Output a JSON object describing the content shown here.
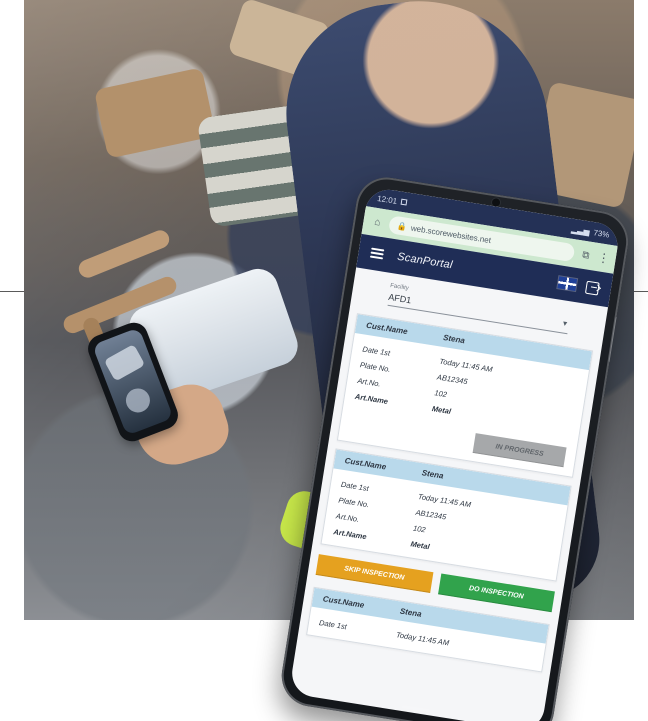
{
  "status": {
    "time": "12:01",
    "battery": "73%"
  },
  "browser": {
    "url": "web.scorewebsites.net"
  },
  "app": {
    "title": "ScanPortal"
  },
  "facility": {
    "label": "Facility",
    "value": "AFD1"
  },
  "cards": [
    {
      "header_left": "Cust.Name",
      "header_right": "Stena",
      "rows": [
        {
          "label": "Date 1st",
          "value": "Today 11:45 AM",
          "bold": false
        },
        {
          "label": "Plate No.",
          "value": "AB12345",
          "bold": false
        },
        {
          "label": "Art.No.",
          "value": "102",
          "bold": false
        },
        {
          "label": "Art.Name",
          "value": "Metal",
          "bold": true
        }
      ],
      "status_button": "IN PROGRESS"
    },
    {
      "header_left": "Cust.Name",
      "header_right": "Stena",
      "rows": [
        {
          "label": "Date 1st",
          "value": "Today 11:45 AM",
          "bold": false
        },
        {
          "label": "Plate No.",
          "value": "AB12345",
          "bold": false
        },
        {
          "label": "Art.No.",
          "value": "102",
          "bold": false
        },
        {
          "label": "Art.Name",
          "value": "Metal",
          "bold": true
        }
      ]
    },
    {
      "header_left": "Cust.Name",
      "header_right": "Stena",
      "rows": [
        {
          "label": "Date 1st",
          "value": "Today 11:45 AM",
          "bold": false
        }
      ]
    }
  ],
  "actions": {
    "skip_label": "SKIP INSPECTION",
    "do_label": "DO INSPECTION"
  },
  "icons": {
    "home": "home-icon",
    "lock": "lock-icon",
    "tabs": "tabs-icon",
    "more": "more-icon",
    "menu": "menu-icon",
    "flag": "uk-flag-icon",
    "logout": "logout-icon",
    "caret": "chevron-down-icon"
  },
  "colors": {
    "header": "#1f2d56",
    "browser_bar": "#cde8cf",
    "card_header": "#b9d9eb",
    "skip": "#e5a11f",
    "do": "#31a34c",
    "status": "#a6a8aa"
  }
}
